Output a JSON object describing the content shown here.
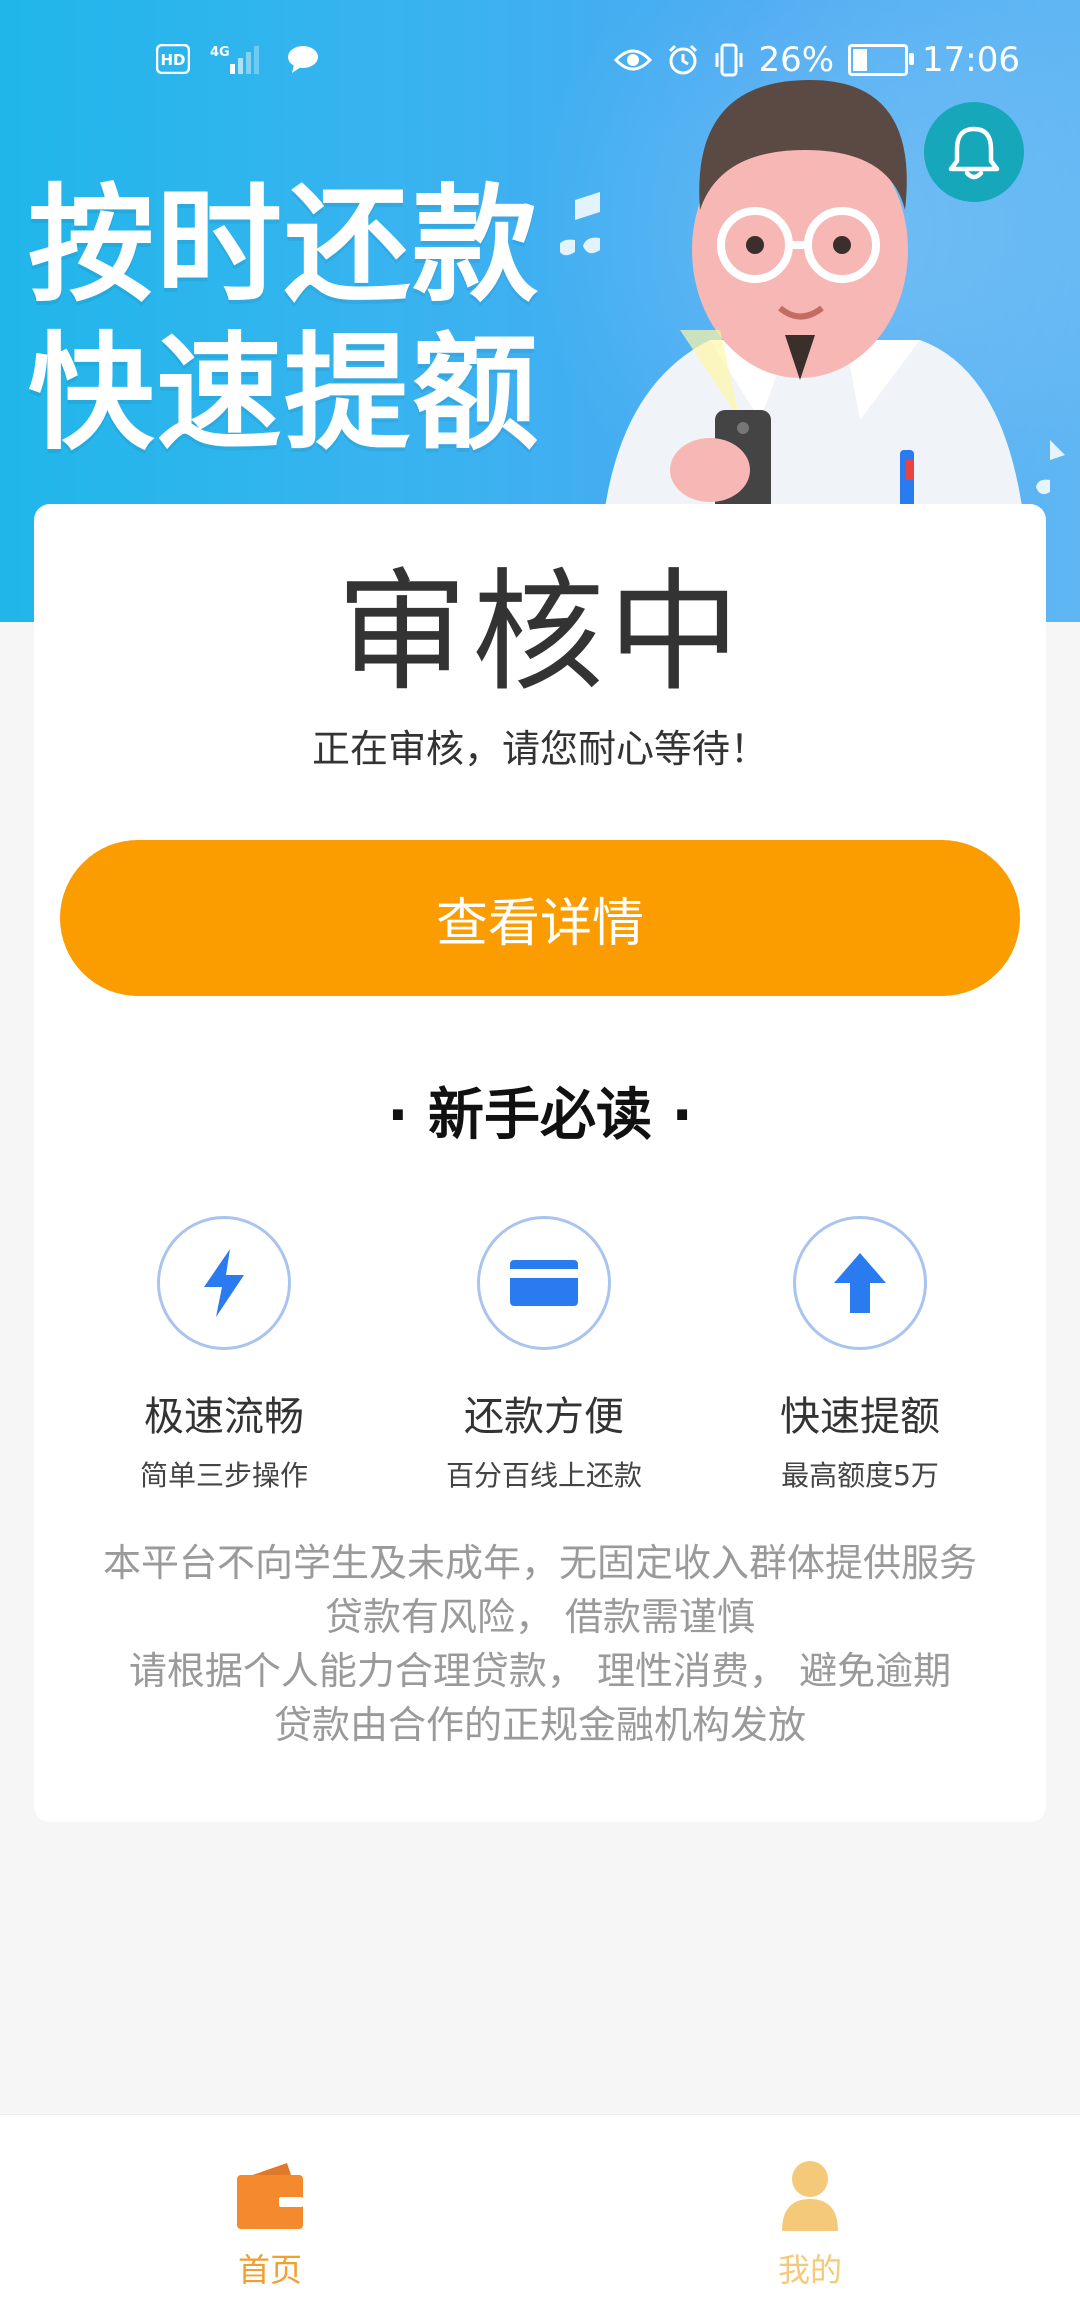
{
  "status_bar": {
    "battery": "26%",
    "time": "17:06",
    "left_icons": [
      "hd-icon",
      "signal-4g-icon",
      "chat-bubble-icon"
    ],
    "right_icons": [
      "eye-icon",
      "alarm-icon",
      "vibrate-icon",
      "battery-icon"
    ],
    "battery_level": 0.26
  },
  "banner": {
    "line1": "按时还款",
    "line2": "快速提额",
    "bell_icon": "bell-icon"
  },
  "card": {
    "status_title": "审核中",
    "status_message": "正在审核，请您耐心等待！",
    "detail_button": "查看详情",
    "guide_title": "· 新手必读 ·"
  },
  "features": [
    {
      "icon": "lightning-icon",
      "title": "极速流畅",
      "subtitle": "简单三步操作"
    },
    {
      "icon": "card-icon",
      "title": "还款方便",
      "subtitle": "百分百线上还款"
    },
    {
      "icon": "arrow-up-icon",
      "title": "快速提额",
      "subtitle": "最高额度5万"
    }
  ],
  "disclaimer": [
    "本平台不向学生及未成年，无固定收入群体提供服务",
    "贷款有风险， 借款需谨慎",
    "请根据个人能力合理贷款， 理性消费， 避免逾期",
    "贷款由合作的正规金融机构发放"
  ],
  "bottom_nav": [
    {
      "label": "首页",
      "icon": "wallet-icon",
      "active": true
    },
    {
      "label": "我的",
      "icon": "user-icon",
      "active": false
    }
  ],
  "colors": {
    "accent": "#fb9c00",
    "nav_active": "#f0a030",
    "nav_inactive": "#f5c97a",
    "feature_icon": "#2b7bf0",
    "feature_ring": "#a9c4ef",
    "bell_bg": "#17a7ba",
    "banner_blue": "#37b4f0"
  }
}
